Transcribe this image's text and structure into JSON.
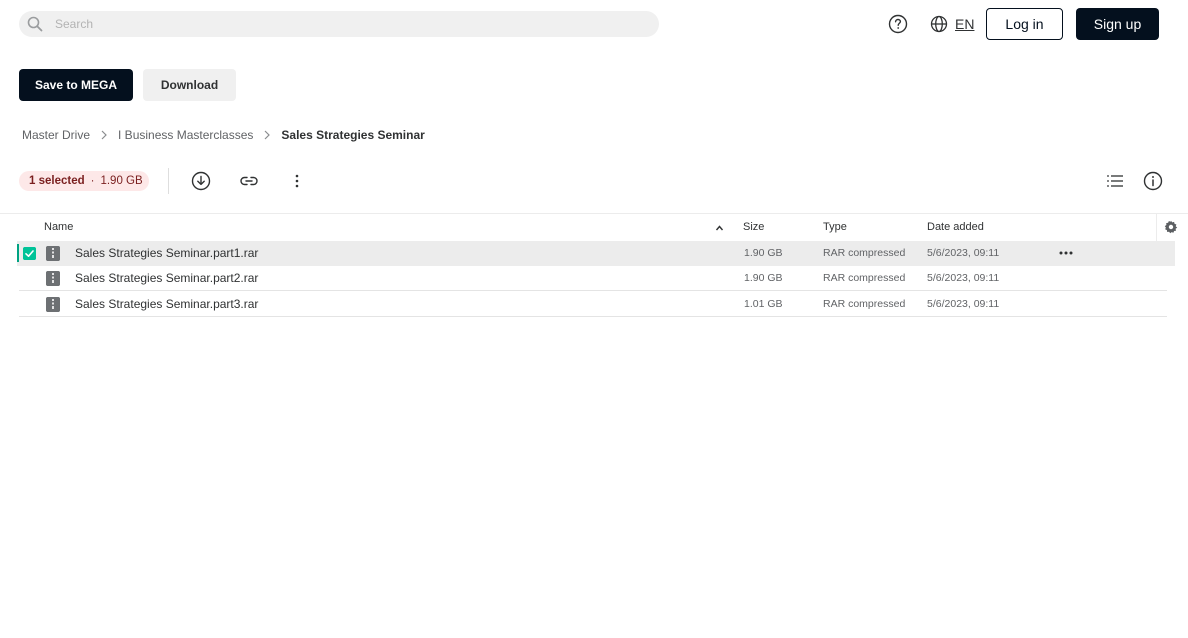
{
  "search": {
    "placeholder": "Search",
    "value": ""
  },
  "header": {
    "language": "EN",
    "login_label": "Log in",
    "signup_label": "Sign up"
  },
  "actions": {
    "save_label": "Save to MEGA",
    "download_label": "Download"
  },
  "breadcrumb": [
    "Master Drive",
    "I Business Masterclasses",
    "Sales Strategies Seminar"
  ],
  "selection": {
    "count_label": "1 selected",
    "separator": "·",
    "size": "1.90 GB"
  },
  "table": {
    "columns": {
      "name": "Name",
      "size": "Size",
      "type": "Type",
      "date": "Date added"
    },
    "rows": [
      {
        "name": "Sales Strategies Seminar.part1.rar",
        "size": "1.90 GB",
        "type": "RAR compressed",
        "date": "5/6/2023, 09:11",
        "selected": true
      },
      {
        "name": "Sales Strategies Seminar.part2.rar",
        "size": "1.90 GB",
        "type": "RAR compressed",
        "date": "5/6/2023, 09:11",
        "selected": false
      },
      {
        "name": "Sales Strategies Seminar.part3.rar",
        "size": "1.01 GB",
        "type": "RAR compressed",
        "date": "5/6/2023, 09:11",
        "selected": false
      }
    ]
  },
  "colors": {
    "primary": "#04101e",
    "selection_accent": "#00c398",
    "badge_bg": "#fde8e8"
  },
  "icons": [
    "search-icon",
    "help-icon",
    "globe-icon",
    "download-icon",
    "link-icon",
    "more-vertical-icon",
    "list-view-icon",
    "info-icon",
    "settings-icon",
    "sort-up-icon",
    "rar-file-icon",
    "more-horizontal-icon",
    "checkbox-checked-icon"
  ]
}
